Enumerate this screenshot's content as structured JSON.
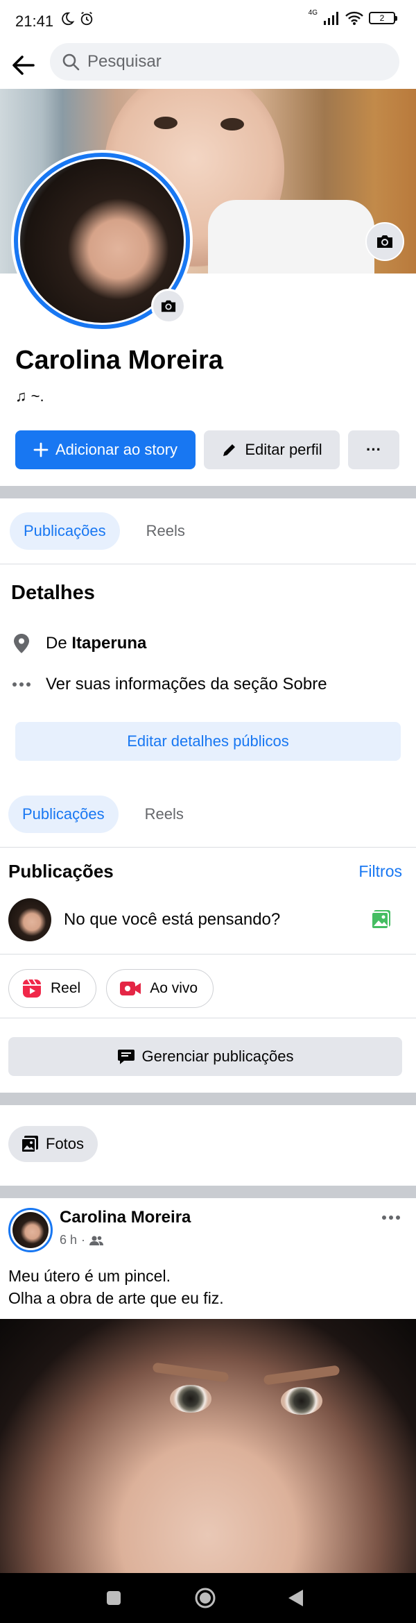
{
  "status_bar": {
    "time": "21:41",
    "network": "4G",
    "battery": "2"
  },
  "search": {
    "placeholder": "Pesquisar"
  },
  "profile": {
    "name": "Carolina Moreira",
    "bio": "♫ ~."
  },
  "actions": {
    "add_story": "Adicionar ao story",
    "edit_profile": "Editar perfil",
    "more": "···"
  },
  "tabs_top": [
    {
      "label": "Publicações",
      "active": true
    },
    {
      "label": "Reels",
      "active": false
    }
  ],
  "details": {
    "title": "Detalhes",
    "from_prefix": "De ",
    "from_place": "Itaperuna",
    "about_text": "Ver suas informações da seção Sobre",
    "edit_button": "Editar detalhes públicos"
  },
  "tabs_bottom": [
    {
      "label": "Publicações",
      "active": true
    },
    {
      "label": "Reels",
      "active": false
    }
  ],
  "posts_section": {
    "title": "Publicações",
    "filters": "Filtros",
    "composer_prompt": "No que você está pensando?",
    "chips": [
      {
        "label": "Reel",
        "icon": "reel-icon"
      },
      {
        "label": "Ao vivo",
        "icon": "live-video-icon"
      }
    ],
    "manage_button": "Gerenciar publicações",
    "photos_chip": "Fotos"
  },
  "post": {
    "author": "Carolina Moreira",
    "time": "6 h",
    "separator": "·",
    "audience_icon": "friends-icon",
    "text_line1": "Meu útero é um pincel.",
    "text_line2": "Olha a obra de arte que eu fiz."
  },
  "colors": {
    "accent": "#1877f2",
    "accent_light": "#e7f0fd",
    "button_gray": "#e4e6eb",
    "divider": "#c9ccd1",
    "muted_text": "#65676b"
  }
}
